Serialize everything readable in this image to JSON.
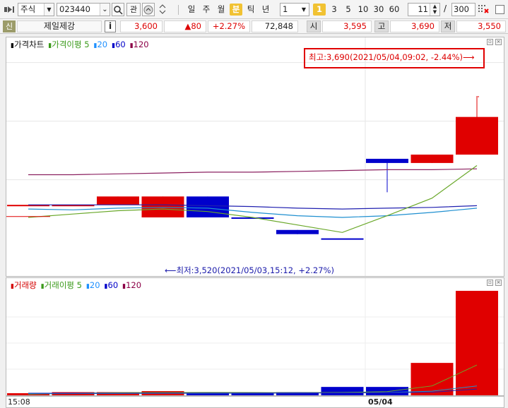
{
  "toolbar": {
    "market_type": "주식",
    "stock_code": "023440",
    "btn_related": "관",
    "period_day": "일",
    "period_week": "주",
    "period_month": "월",
    "period_minute": "분",
    "period_tick": "틱",
    "period_year": "년",
    "interval_value": "1",
    "quick_intervals": [
      "1",
      "3",
      "5",
      "10",
      "30",
      "60"
    ],
    "selected_interval": "1",
    "spin_value": "11",
    "slash": "/",
    "count_value": "300"
  },
  "quote": {
    "credit_badge": "신",
    "stock_name": "제일제강",
    "info_btn": "i",
    "price": "3,600",
    "change": "▲80",
    "change_rate": "+2.27%",
    "volume": "72,848",
    "open_label": "시",
    "open": "3,595",
    "high_label": "고",
    "high": "3,690",
    "low_label": "저",
    "low": "3,550"
  },
  "price_panel": {
    "legend": [
      {
        "text": "가격차트",
        "color": "#000000"
      },
      {
        "text": "가격이평 5",
        "color": "#3a9a1a"
      },
      {
        "text": "20",
        "color": "#1e90ff"
      },
      {
        "text": "60",
        "color": "#0000c8"
      },
      {
        "text": "120",
        "color": "#8b0046"
      }
    ],
    "high_annotation": "최고:3,690(2021/05/04,09:02, -2.44%)⟶",
    "low_annotation": "⟵최저:3,520(2021/05/03,15:12, +2.27%)"
  },
  "volume_panel": {
    "legend": [
      {
        "text": "거래량",
        "color": "#d40000"
      },
      {
        "text": "거래이평 5",
        "color": "#3a9a1a"
      },
      {
        "text": "20",
        "color": "#1e90ff"
      },
      {
        "text": "60",
        "color": "#0000c8"
      },
      {
        "text": "120",
        "color": "#8b0046"
      }
    ]
  },
  "xaxis": {
    "labels": [
      "15:08",
      "05/04"
    ]
  },
  "colors": {
    "up": "#e00000",
    "down": "#0000cc",
    "ma5": "#6aa82a",
    "ma20": "#1e8fd0",
    "ma60": "#2020b0",
    "ma120": "#8b2060",
    "selected": "#f1c232"
  },
  "chart_data": {
    "type": "candlestick",
    "candles": [
      {
        "open": 3560,
        "high": 3560,
        "low": 3560,
        "close": 3560,
        "color": "red"
      },
      {
        "open": 3560,
        "high": 3560,
        "low": 3560,
        "close": 3560,
        "color": "red"
      },
      {
        "open": 3560,
        "high": 3570,
        "low": 3560,
        "close": 3570,
        "color": "red"
      },
      {
        "open": 3545,
        "high": 3570,
        "low": 3545,
        "close": 3570,
        "color": "red"
      },
      {
        "open": 3570,
        "high": 3570,
        "low": 3545,
        "close": 3545,
        "color": "blue"
      },
      {
        "open": 3545,
        "high": 3545,
        "low": 3545,
        "close": 3545,
        "color": "blue"
      },
      {
        "open": 3530,
        "high": 3530,
        "low": 3525,
        "close": 3525,
        "color": "blue"
      },
      {
        "open": 3520,
        "high": 3520,
        "low": 3520,
        "close": 3520,
        "color": "blue"
      },
      {
        "open": 3615,
        "high": 3615,
        "low": 3575,
        "close": 3610,
        "color": "blue"
      },
      {
        "open": 3610,
        "high": 3620,
        "low": 3610,
        "close": 3620,
        "color": "red"
      },
      {
        "open": 3620,
        "high": 3690,
        "low": 3620,
        "close": 3665,
        "color": "red"
      }
    ],
    "volume_rel": [
      0.02,
      0.03,
      0.03,
      0.04,
      0.03,
      0.02,
      0.03,
      0.08,
      0.08,
      0.31,
      1.0
    ]
  }
}
